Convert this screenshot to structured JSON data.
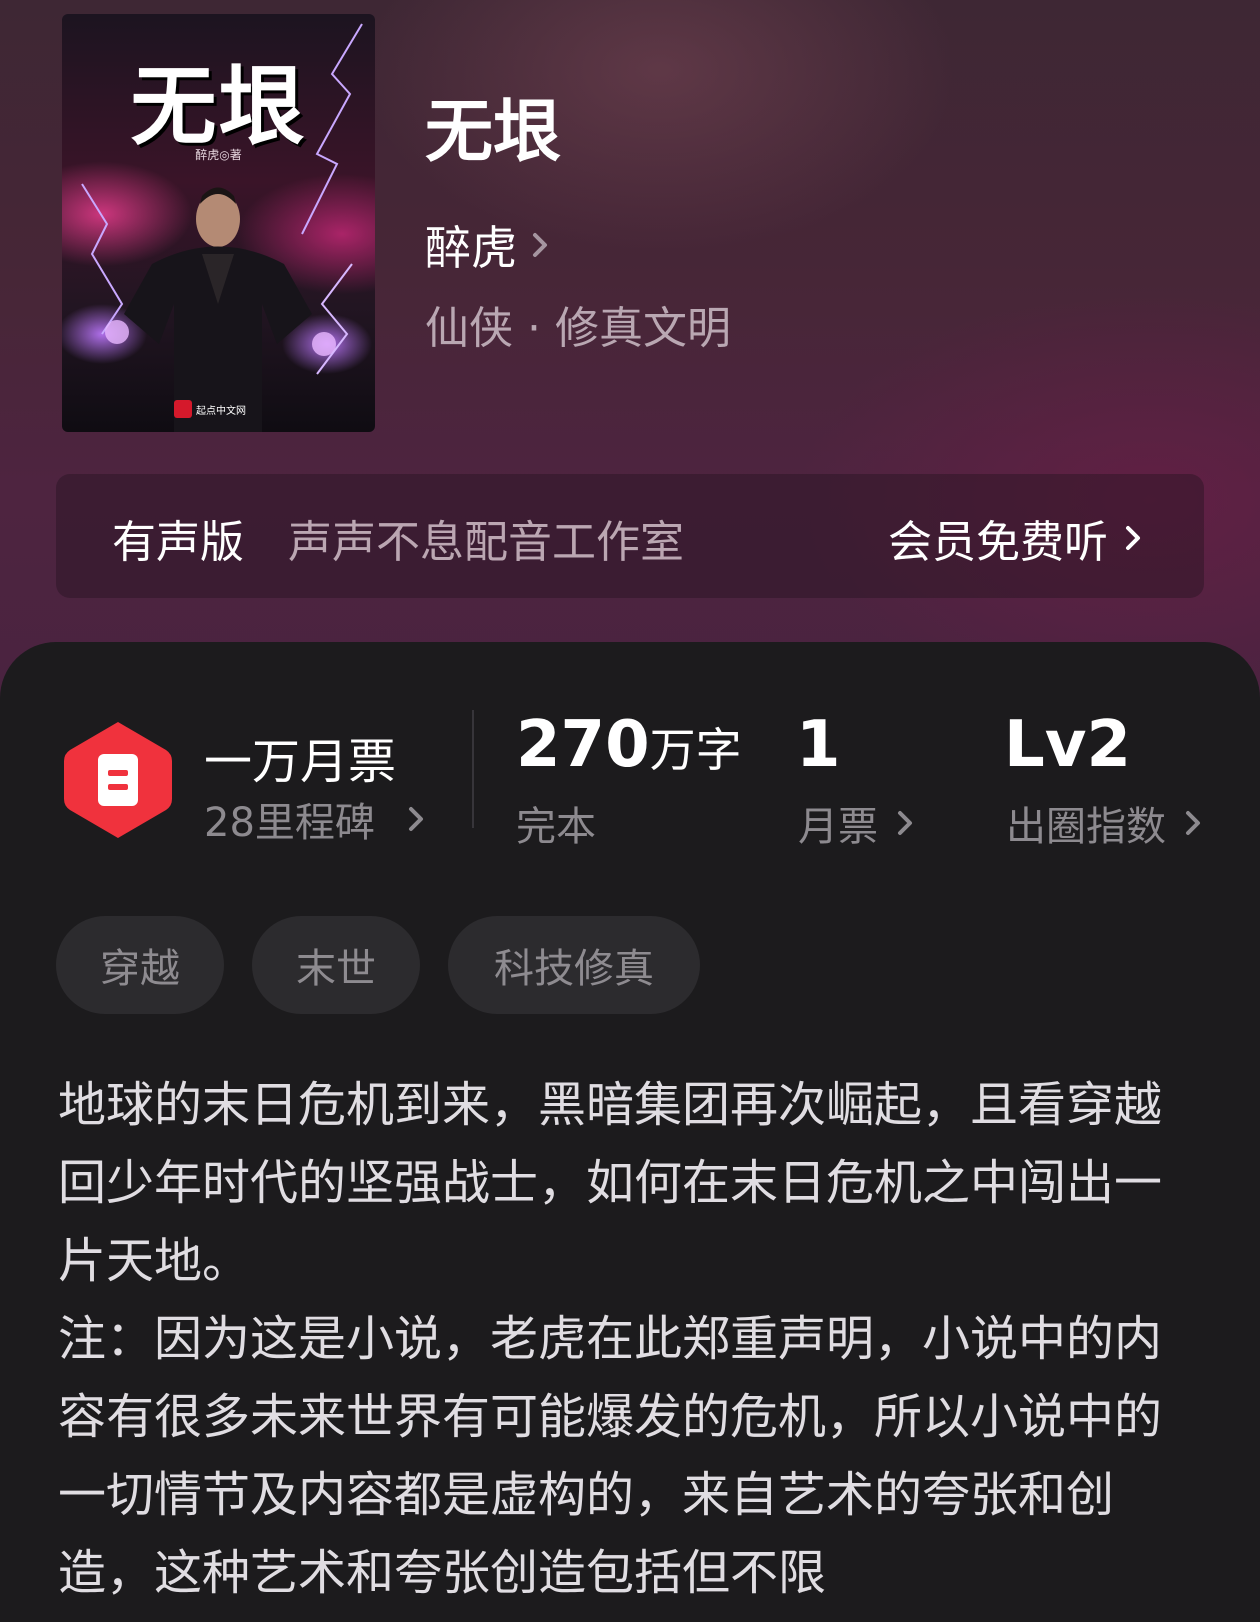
{
  "cover": {
    "title": "无垠",
    "author_line": "醉虎◎著",
    "publisher": "起点中文网"
  },
  "book": {
    "title": "无垠",
    "author": "醉虎",
    "genre": "仙侠 · 修真文明"
  },
  "audio": {
    "label": "有声版",
    "studio": "声声不息配音工作室",
    "cta": "会员免费听"
  },
  "ticket": {
    "title": "一万月票",
    "subtitle": "28里程碑"
  },
  "stats": {
    "words_value": "270",
    "words_unit": "万字",
    "words_label": "完本",
    "monthly_value": "1",
    "monthly_label": "月票",
    "level_value": "Lv2",
    "level_label": "出圈指数"
  },
  "tags": [
    "穿越",
    "末世",
    "科技修真"
  ],
  "description": {
    "para1": "地球的末日危机到来，黑暗集团再次崛起，且看穿越回少年时代的坚强战士，如何在末日危机之中闯出一片天地。",
    "para2": "注：因为这是小说，老虎在此郑重声明，小说中的内容有很多未来世界有可能爆发的危机，所以小说中的一切情节及内容都是虚构的，来自艺术的夸张和创造，这种艺术和夸张创造包括但不限"
  },
  "colors": {
    "accent_red": "#f0323d",
    "hero_bg": "#472637",
    "panel_bg": "#1c1b1d"
  },
  "icons": [
    "chevron-right-icon",
    "monthly-ticket-icon"
  ]
}
